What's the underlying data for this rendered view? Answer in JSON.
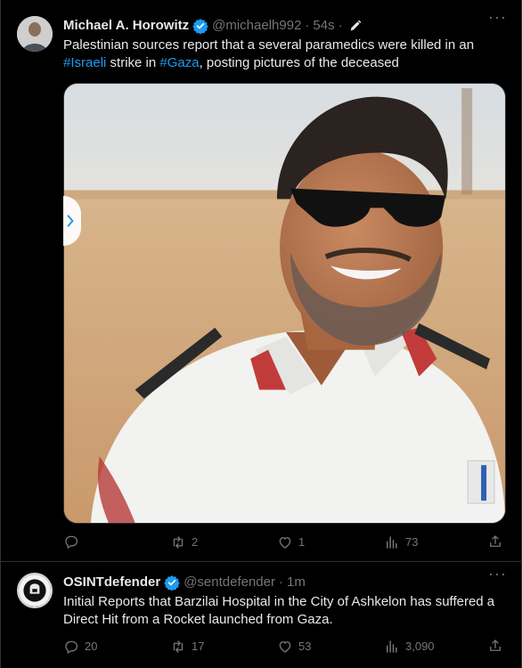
{
  "tweets": [
    {
      "author_name": "Michael A. Horowitz",
      "handle": "@michaelh992",
      "separator": "·",
      "time": "54s",
      "text_parts": [
        "Palestinian sources report that a several paramedics were killed in an ",
        "#Israeli",
        " strike in ",
        "#Gaza",
        ", posting pictures of the deceased"
      ],
      "actions": {
        "reply": "",
        "retweet": "2",
        "like": "1",
        "views": "73"
      }
    },
    {
      "author_name": "OSINTdefender",
      "handle": "@sentdefender",
      "separator": "·",
      "time": "1m",
      "text": "Initial Reports that Barzilai Hospital in the City of Ashkelon has suffered a Direct Hit from a Rocket launched from Gaza.",
      "actions": {
        "reply": "20",
        "retweet": "17",
        "like": "53",
        "views": "3,090"
      }
    }
  ],
  "icons": {
    "verified": "verified-badge-icon",
    "edit": "edit-pencil-icon",
    "reply": "reply-icon",
    "retweet": "retweet-icon",
    "like": "heart-icon",
    "views": "views-chart-icon",
    "share": "share-icon",
    "more": "more-dots-icon",
    "carousel_prev": "chevron-left-icon"
  },
  "colors": {
    "background": "#000000",
    "text": "#e7e9ea",
    "muted": "#71767b",
    "accent": "#1d9bf0",
    "border": "#2f3336"
  }
}
